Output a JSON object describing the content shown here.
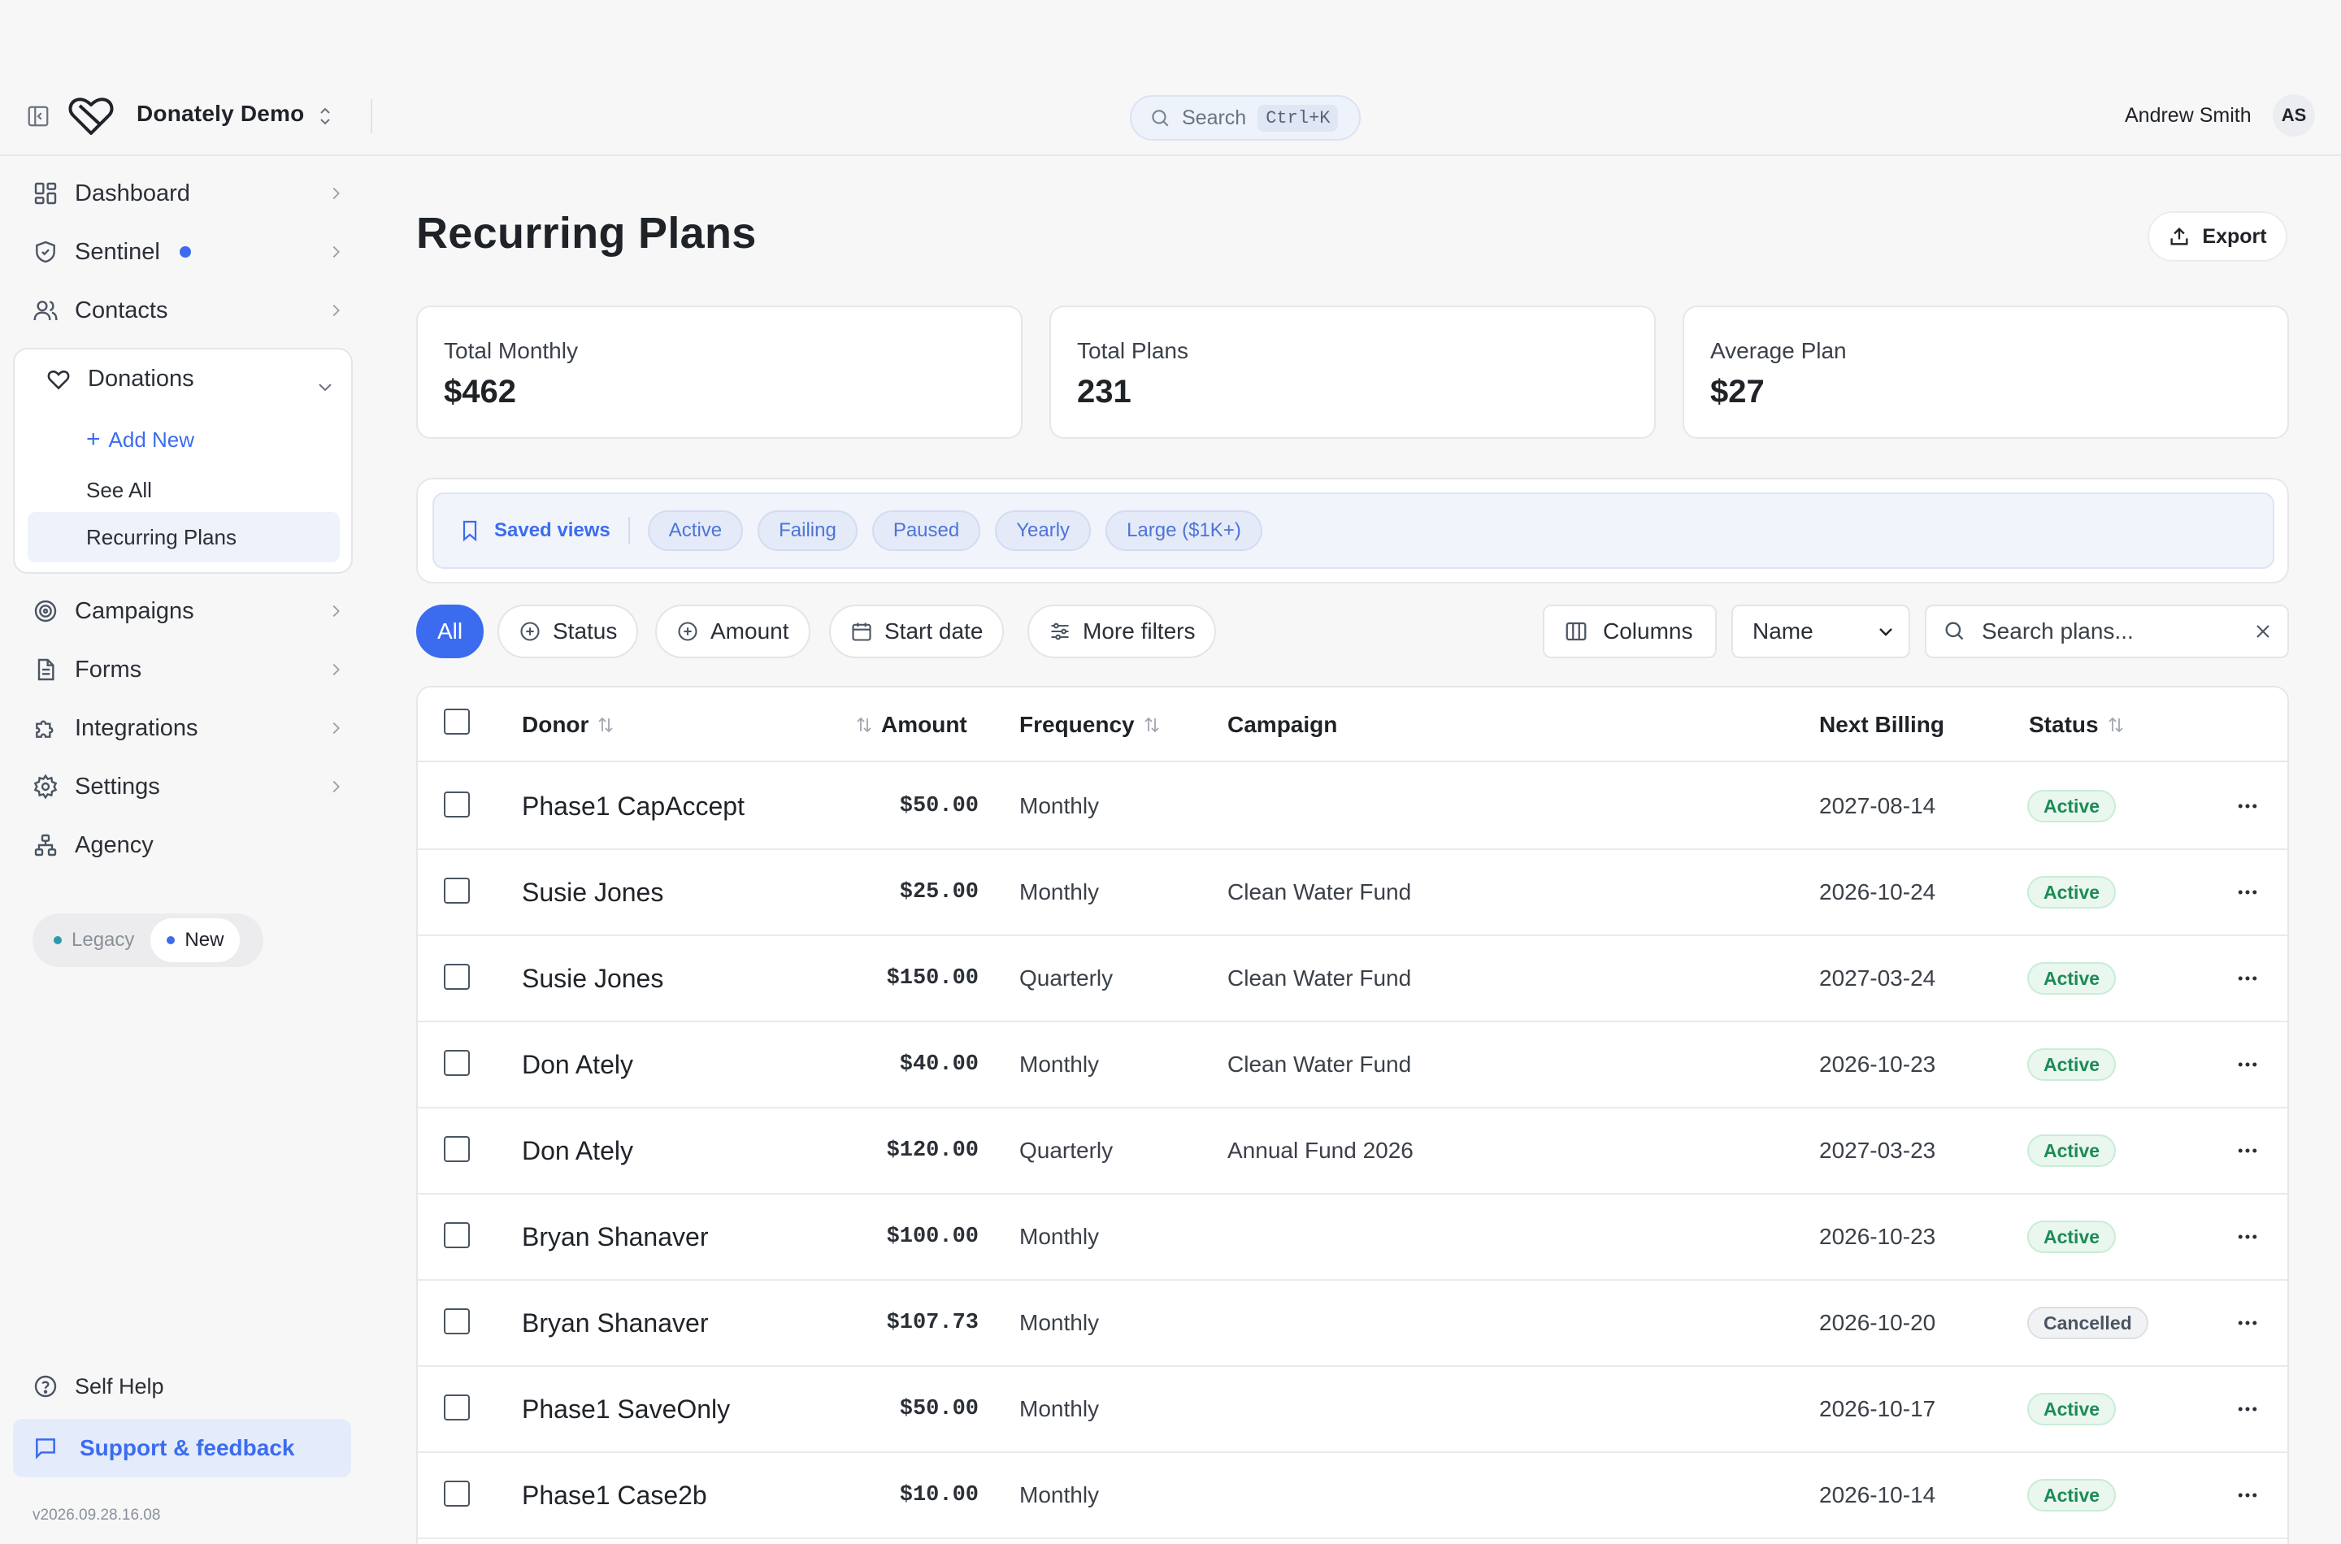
{
  "header": {
    "org_name": "Donately Demo",
    "search_label": "Search",
    "search_shortcut": "Ctrl+K",
    "user_name": "Andrew Smith",
    "user_initials": "AS"
  },
  "sidebar": {
    "items": [
      {
        "label": "Dashboard",
        "icon": "dashboard-icon"
      },
      {
        "label": "Sentinel",
        "icon": "shield-icon"
      },
      {
        "label": "Contacts",
        "icon": "users-icon"
      }
    ],
    "donations": {
      "label": "Donations",
      "icon": "heart-icon",
      "add_new": "Add New",
      "see_all": "See All",
      "recurring_plans": "Recurring Plans"
    },
    "items_after": [
      {
        "label": "Campaigns",
        "icon": "target-icon"
      },
      {
        "label": "Forms",
        "icon": "document-icon"
      },
      {
        "label": "Integrations",
        "icon": "puzzle-icon"
      },
      {
        "label": "Settings",
        "icon": "gear-icon"
      },
      {
        "label": "Agency",
        "icon": "network-icon"
      }
    ],
    "version_toggle": {
      "legacy": "Legacy",
      "new": "New"
    },
    "self_help": "Self Help",
    "support": "Support & feedback",
    "version": "v2026.09.28.16.08"
  },
  "main": {
    "title": "Recurring Plans",
    "export_label": "Export",
    "stats": [
      {
        "label": "Total Monthly",
        "value": "$462"
      },
      {
        "label": "Total Plans",
        "value": "231"
      },
      {
        "label": "Average Plan",
        "value": "$27"
      }
    ],
    "saved_views": {
      "label": "Saved views",
      "views": [
        "Active",
        "Failing",
        "Paused",
        "Yearly",
        "Large ($1K+)"
      ]
    },
    "filters": {
      "all": "All",
      "status": "Status",
      "amount": "Amount",
      "start_date": "Start date",
      "more": "More filters",
      "columns": "Columns",
      "sort_select": "Name",
      "search_placeholder": "Search plans..."
    },
    "table": {
      "columns": {
        "donor": "Donor",
        "amount": "Amount",
        "frequency": "Frequency",
        "campaign": "Campaign",
        "next_billing": "Next Billing",
        "status": "Status"
      },
      "rows": [
        {
          "donor": "Phase1 CapAccept",
          "amount": "$50.00",
          "frequency": "Monthly",
          "campaign": "",
          "next_billing": "2027-08-14",
          "status": "Active"
        },
        {
          "donor": "Susie Jones",
          "amount": "$25.00",
          "frequency": "Monthly",
          "campaign": "Clean Water Fund",
          "next_billing": "2026-10-24",
          "status": "Active"
        },
        {
          "donor": "Susie Jones",
          "amount": "$150.00",
          "frequency": "Quarterly",
          "campaign": "Clean Water Fund",
          "next_billing": "2027-03-24",
          "status": "Active"
        },
        {
          "donor": "Don Ately",
          "amount": "$40.00",
          "frequency": "Monthly",
          "campaign": "Clean Water Fund",
          "next_billing": "2026-10-23",
          "status": "Active"
        },
        {
          "donor": "Don Ately",
          "amount": "$120.00",
          "frequency": "Quarterly",
          "campaign": "Annual Fund 2026",
          "next_billing": "2027-03-23",
          "status": "Active"
        },
        {
          "donor": "Bryan Shanaver",
          "amount": "$100.00",
          "frequency": "Monthly",
          "campaign": "",
          "next_billing": "2026-10-23",
          "status": "Active"
        },
        {
          "donor": "Bryan Shanaver",
          "amount": "$107.73",
          "frequency": "Monthly",
          "campaign": "",
          "next_billing": "2026-10-20",
          "status": "Cancelled"
        },
        {
          "donor": "Phase1 SaveOnly",
          "amount": "$50.00",
          "frequency": "Monthly",
          "campaign": "",
          "next_billing": "2026-10-17",
          "status": "Active"
        },
        {
          "donor": "Phase1 Case2b",
          "amount": "$10.00",
          "frequency": "Monthly",
          "campaign": "",
          "next_billing": "2026-10-14",
          "status": "Active"
        }
      ]
    }
  },
  "colors": {
    "accent": "#3b6cf0",
    "active_green": "#1c8b54",
    "page_bg": "#f7f7f8"
  }
}
